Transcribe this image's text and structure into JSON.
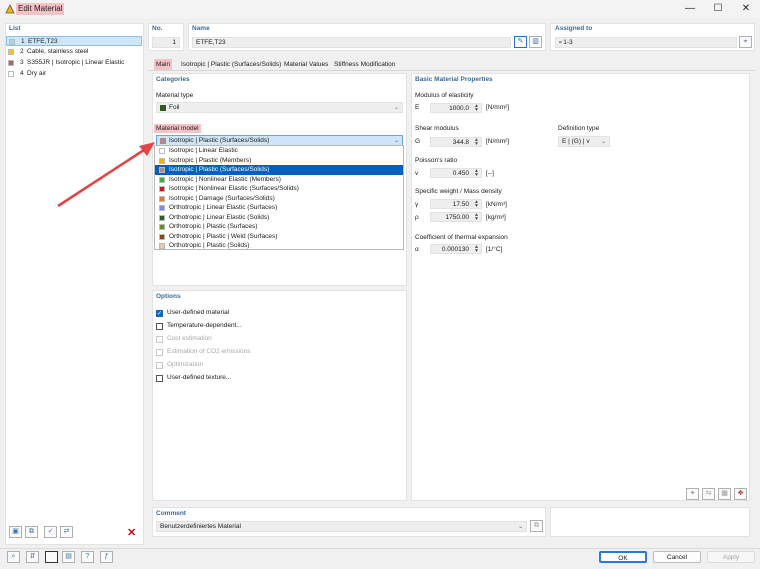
{
  "window": {
    "title": "Edit Material",
    "minimize": "—",
    "maximize": "☐",
    "close": "✕"
  },
  "list": {
    "header": "List",
    "items": [
      {
        "num": "1",
        "name": "ETFE,T23",
        "color": "#a8d4ee"
      },
      {
        "num": "2",
        "name": "Cable, stainless steel",
        "color": "#f0c419"
      },
      {
        "num": "3",
        "name": "S355JR | Isotropic | Linear Elastic",
        "color": "#a06a58"
      },
      {
        "num": "4",
        "name": "Dry air",
        "color": "#ffffff"
      }
    ]
  },
  "header": {
    "no_label": "No.",
    "no_value": "1",
    "name_label": "Name",
    "name_value": "ETFE,T23",
    "assigned_label": "Assigned to",
    "assigned_value": "1-3"
  },
  "tabs": [
    "Main",
    "Isotropic | Plastic (Surfaces/Solids)",
    "Material Values",
    "Stiffness Modification"
  ],
  "categories": {
    "header": "Categories",
    "material_type_label": "Material type",
    "material_type_value": "Foil",
    "material_type_color": "#2e5c1e",
    "material_model_label": "Material model",
    "material_model_value": "Isotropic | Plastic (Surfaces/Solids)",
    "material_model_color": "#b08a8a"
  },
  "model_options": [
    {
      "label": "Isotropic | Linear Elastic",
      "color": "#ffffff"
    },
    {
      "label": "Isotropic | Plastic (Members)",
      "color": "#f0b400"
    },
    {
      "label": "Isotropic | Plastic (Surfaces/Solids)",
      "color": "#b08a8a"
    },
    {
      "label": "Isotropic | Nonlinear Elastic (Members)",
      "color": "#3cb034"
    },
    {
      "label": "Isotropic | Nonlinear Elastic (Surfaces/Solids)",
      "color": "#d01818"
    },
    {
      "label": "Isotropic | Damage (Surfaces/Solids)",
      "color": "#e07a2e"
    },
    {
      "label": "Orthotropic | Linear Elastic (Surfaces)",
      "color": "#7a8ae8"
    },
    {
      "label": "Orthotropic | Linear Elastic (Solids)",
      "color": "#2e5c1e"
    },
    {
      "label": "Orthotropic | Plastic (Surfaces)",
      "color": "#6b8e23"
    },
    {
      "label": "Orthotropic | Plastic | Weld (Surfaces)",
      "color": "#8b4513"
    },
    {
      "label": "Orthotropic | Plastic (Solids)",
      "color": "#f0c8a0"
    }
  ],
  "model_selected_index": 2,
  "options": {
    "header": "Options",
    "items": [
      {
        "label": "User-defined material",
        "checked": true,
        "disabled": false
      },
      {
        "label": "Temperature-dependent...",
        "checked": false,
        "disabled": false
      },
      {
        "label": "Cost estimation",
        "checked": false,
        "disabled": true
      },
      {
        "label": "Estimation of CO2 emissions",
        "checked": false,
        "disabled": true
      },
      {
        "label": "Optimization",
        "checked": false,
        "disabled": true
      },
      {
        "label": "User-defined texture...",
        "checked": false,
        "disabled": false
      }
    ]
  },
  "basic": {
    "header": "Basic Material Properties",
    "moe_label": "Modulus of elasticity",
    "e_sym": "E",
    "e_val": "1000.0",
    "e_unit": "[N/mm²]",
    "shear_label": "Shear modulus",
    "g_sym": "G",
    "g_val": "344.8",
    "g_unit": "[N/mm²]",
    "def_label": "Definition type",
    "def_val": "E | (G) | v",
    "poisson_label": "Poisson's ratio",
    "v_sym": "v",
    "v_val": "0.450",
    "v_unit": "[--]",
    "weight_label": "Specific weight / Mass density",
    "gamma_sym": "γ",
    "gamma_val": "17.50",
    "gamma_unit": "[kN/m³]",
    "rho_sym": "ρ",
    "rho_val": "1750.00",
    "rho_unit": "[kg/m³]",
    "thermal_label": "Coefficient of thermal expansion",
    "alpha_sym": "α",
    "alpha_val": "0.000130",
    "alpha_unit": "[1/°C]"
  },
  "comment": {
    "header": "Comment",
    "value": "Benutzerdefiniertes Material"
  },
  "buttons": {
    "ok": "OK",
    "cancel": "Cancel",
    "apply": "Apply"
  },
  "accent": "#f2c2c6"
}
